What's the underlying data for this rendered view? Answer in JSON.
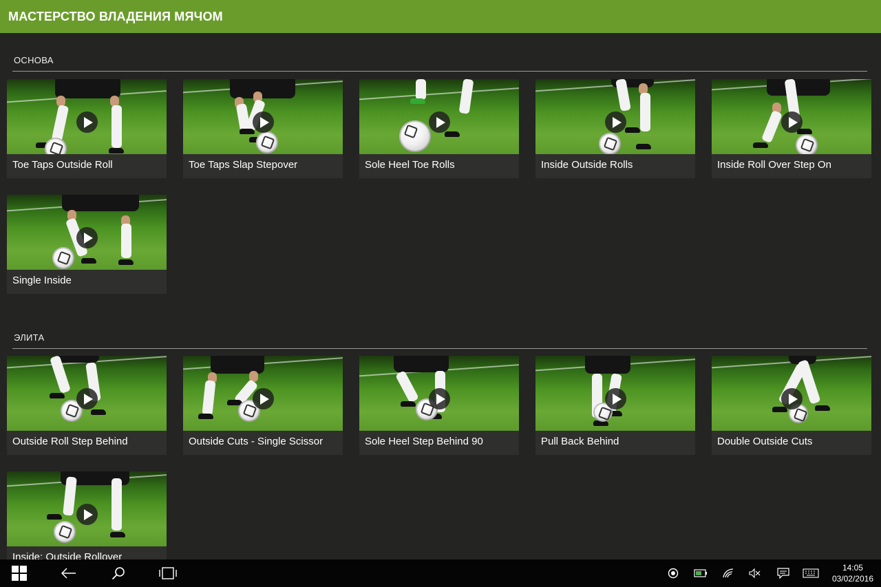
{
  "header": {
    "title": "МАСТЕРСТВО ВЛАДЕНИЯ МЯЧОМ"
  },
  "sections": [
    {
      "label": "ОСНОВА",
      "items": [
        {
          "title": "Toe Taps Outside Roll"
        },
        {
          "title": "Toe Taps Slap Stepover"
        },
        {
          "title": "Sole Heel Toe Rolls"
        },
        {
          "title": "Inside Outside Rolls"
        },
        {
          "title": "Inside Roll Over Step On"
        },
        {
          "title": "Single Inside"
        }
      ]
    },
    {
      "label": "ЭЛИТА",
      "items": [
        {
          "title": "Outside Roll Step Behind"
        },
        {
          "title": "Outside Cuts - Single Scissor"
        },
        {
          "title": "Sole Heel Step Behind 90"
        },
        {
          "title": "Pull Back Behind"
        },
        {
          "title": "Double Outside Cuts"
        },
        {
          "title": "Inside: Outside Rollover"
        }
      ]
    }
  ],
  "taskbar": {
    "icons": [
      "windows-start-icon",
      "back-arrow-icon",
      "search-icon",
      "task-view-icon"
    ],
    "tray": [
      "record-icon",
      "battery-icon",
      "wifi-icon",
      "volume-muted-icon",
      "action-center-icon",
      "keyboard-icon"
    ],
    "time": "14:05",
    "date": "03/02/2016"
  },
  "colors": {
    "header": "#6a9c2b",
    "background": "#242422",
    "tile": "#2f2f2d",
    "taskbar": "#050505"
  }
}
